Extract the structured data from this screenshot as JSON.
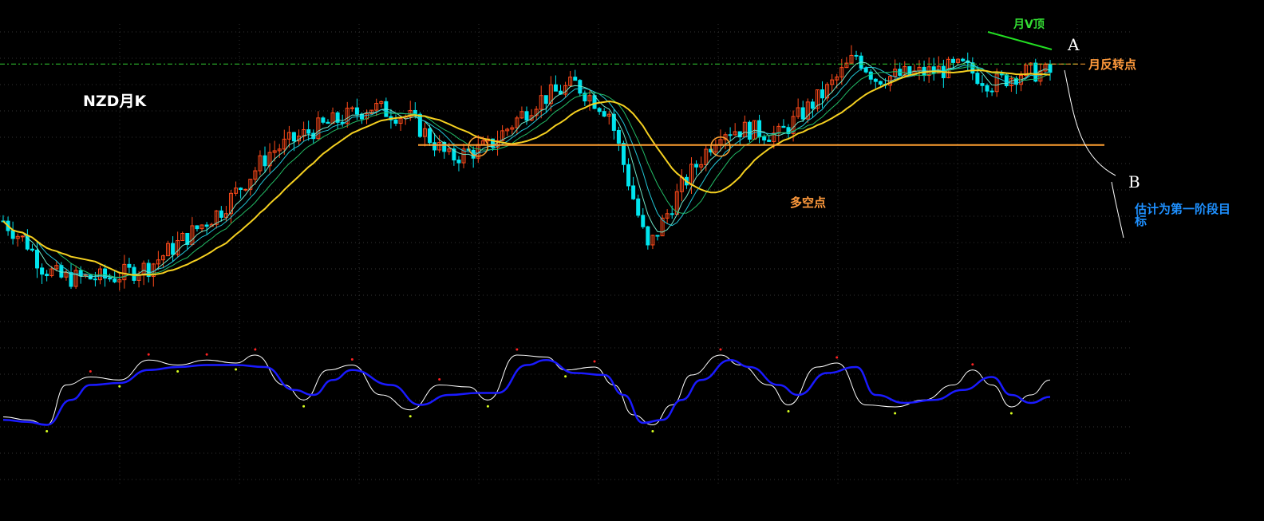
{
  "labels": {
    "title": "NZD月K",
    "monthly_v_top": "月V顶",
    "point_a": "A",
    "point_b": "B",
    "monthly_reversal_point": "月反转点",
    "long_short_point": "多空点",
    "target_note": "估计为第一阶段目标"
  },
  "colors": {
    "background": "#000000",
    "grid": "#333333",
    "candle_up": "#ff4a1a",
    "candle_down": "#00e5ee",
    "ma_yellow": "#f5d020",
    "ma_cyan": "#22c8d8",
    "ma_green": "#22bb66",
    "ma_teal": "#6ee6c8",
    "support_line": "#ffa030",
    "reversal_line": "#33cc33",
    "v_top_line": "#22dd22",
    "osc_fast": "#ffffff",
    "osc_slow": "#1a1aff",
    "osc_top_dot": "#ff2222",
    "osc_bottom_dot": "#d8ff20",
    "projection": "#ffffff"
  },
  "chart_data": [
    {
      "type": "candlestick",
      "title": "NZD月K",
      "ylim": [
        0.4,
        0.92
      ],
      "grid": "dotted",
      "month_count": 217,
      "anchors": [
        [
          0,
          0.6
        ],
        [
          5,
          0.56
        ],
        [
          8,
          0.52
        ],
        [
          12,
          0.5
        ],
        [
          22,
          0.5
        ],
        [
          30,
          0.52
        ],
        [
          45,
          0.62
        ],
        [
          55,
          0.72
        ],
        [
          64,
          0.76
        ],
        [
          76,
          0.8
        ],
        [
          84,
          0.78
        ],
        [
          92,
          0.71
        ],
        [
          100,
          0.73
        ],
        [
          110,
          0.81
        ],
        [
          118,
          0.84
        ],
        [
          125,
          0.79
        ],
        [
          133,
          0.55
        ],
        [
          140,
          0.66
        ],
        [
          148,
          0.76
        ],
        [
          154,
          0.76
        ],
        [
          160,
          0.75
        ],
        [
          170,
          0.83
        ],
        [
          176,
          0.89
        ],
        [
          180,
          0.85
        ],
        [
          190,
          0.86
        ],
        [
          198,
          0.87
        ],
        [
          204,
          0.84
        ],
        [
          210,
          0.86
        ],
        [
          216,
          0.86
        ]
      ],
      "overlays": [
        {
          "name": "月反转点",
          "type": "hline",
          "value": 0.875
        },
        {
          "name": "多空点",
          "type": "hline",
          "value": 0.733
        }
      ],
      "circles_at_month": [
        98,
        148
      ]
    },
    {
      "type": "line",
      "title": "",
      "ylim": [
        0,
        100
      ],
      "series": [
        {
          "role": "fast",
          "points": [
            [
              0,
              38
            ],
            [
              5,
              35
            ],
            [
              9,
              30
            ],
            [
              13,
              70
            ],
            [
              18,
              78
            ],
            [
              24,
              75
            ],
            [
              30,
              95
            ],
            [
              36,
              90
            ],
            [
              42,
              95
            ],
            [
              48,
              92
            ],
            [
              52,
              100
            ],
            [
              58,
              70
            ],
            [
              62,
              55
            ],
            [
              67,
              85
            ],
            [
              72,
              90
            ],
            [
              78,
              60
            ],
            [
              84,
              45
            ],
            [
              90,
              70
            ],
            [
              96,
              68
            ],
            [
              100,
              55
            ],
            [
              106,
              100
            ],
            [
              112,
              98
            ],
            [
              116,
              85
            ],
            [
              122,
              88
            ],
            [
              126,
              70
            ],
            [
              130,
              40
            ],
            [
              134,
              30
            ],
            [
              138,
              50
            ],
            [
              142,
              80
            ],
            [
              148,
              100
            ],
            [
              152,
              90
            ],
            [
              158,
              70
            ],
            [
              162,
              50
            ],
            [
              168,
              88
            ],
            [
              172,
              92
            ],
            [
              178,
              50
            ],
            [
              184,
              48
            ],
            [
              190,
              55
            ],
            [
              196,
              70
            ],
            [
              200,
              85
            ],
            [
              204,
              70
            ],
            [
              208,
              48
            ],
            [
              212,
              60
            ],
            [
              216,
              75
            ]
          ]
        },
        {
          "role": "slow",
          "points": [
            [
              0,
              35
            ],
            [
              5,
              33
            ],
            [
              9,
              30
            ],
            [
              14,
              55
            ],
            [
              18,
              70
            ],
            [
              24,
              72
            ],
            [
              30,
              85
            ],
            [
              36,
              88
            ],
            [
              42,
              90
            ],
            [
              48,
              90
            ],
            [
              54,
              88
            ],
            [
              60,
              65
            ],
            [
              64,
              60
            ],
            [
              68,
              75
            ],
            [
              72,
              85
            ],
            [
              80,
              70
            ],
            [
              86,
              50
            ],
            [
              92,
              60
            ],
            [
              98,
              62
            ],
            [
              102,
              62
            ],
            [
              108,
              90
            ],
            [
              112,
              95
            ],
            [
              118,
              82
            ],
            [
              124,
              80
            ],
            [
              128,
              60
            ],
            [
              132,
              32
            ],
            [
              136,
              35
            ],
            [
              140,
              55
            ],
            [
              144,
              75
            ],
            [
              150,
              95
            ],
            [
              154,
              88
            ],
            [
              160,
              70
            ],
            [
              164,
              60
            ],
            [
              170,
              82
            ],
            [
              176,
              88
            ],
            [
              180,
              60
            ],
            [
              186,
              52
            ],
            [
              192,
              55
            ],
            [
              198,
              65
            ],
            [
              204,
              78
            ],
            [
              208,
              60
            ],
            [
              212,
              52
            ],
            [
              216,
              58
            ]
          ]
        }
      ]
    }
  ]
}
